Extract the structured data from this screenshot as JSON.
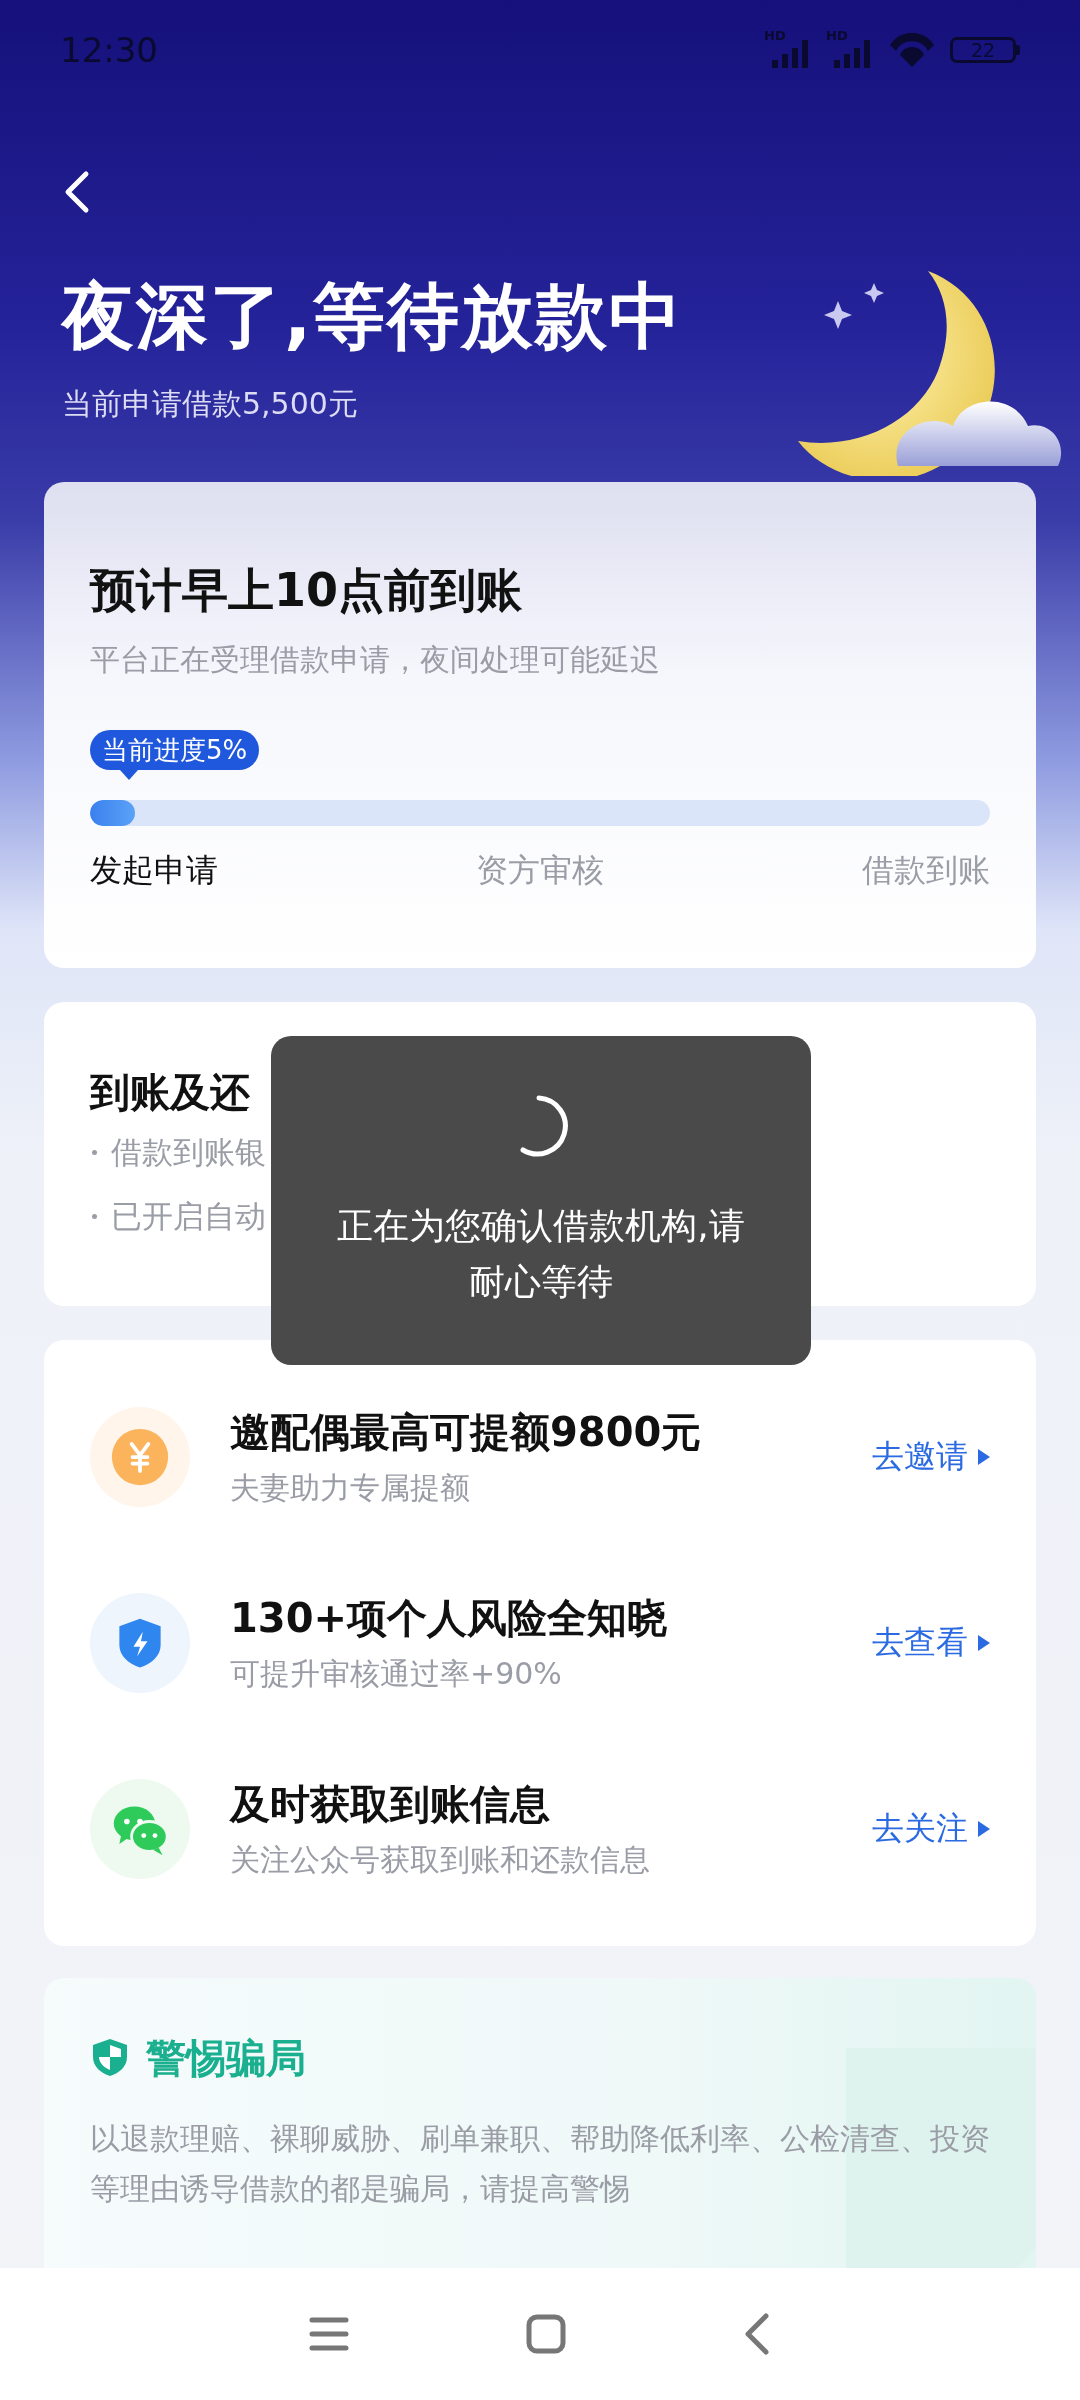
{
  "status_bar": {
    "time": "12:30",
    "signals": [
      {
        "label": "HD"
      },
      {
        "label": "HD"
      }
    ],
    "battery": "22"
  },
  "header": {
    "title": "夜深了,等待放款中",
    "subtitle": "当前申请借款5,500元"
  },
  "progress_card": {
    "title": "预计早上10点前到账",
    "subtitle": "平台正在受理借款申请，夜间处理可能延迟",
    "badge": "当前进度5%",
    "level": 0.05,
    "steps": [
      {
        "label": "发起申请",
        "done": true
      },
      {
        "label": "资方审核",
        "done": false
      },
      {
        "label": "借款到账",
        "done": false
      }
    ]
  },
  "reminder_card": {
    "title": "到账及还",
    "lines": [
      {
        "parts": [
          "借款到账银"
        ]
      },
      {
        "parts": [
          "已开启自动"
        ]
      }
    ]
  },
  "offers": [
    {
      "kind": "yen",
      "title": "邀配偶最高可提额9800元",
      "subtitle": "夫妻助力专属提额",
      "action": "去邀请"
    },
    {
      "kind": "shield",
      "title": "130+项个人风险全知晓",
      "subtitle": "可提升审核通过率+90%",
      "action": "去查看"
    },
    {
      "kind": "chat",
      "title": "及时获取到账信息",
      "subtitle": "关注公众号获取到账和还款信息",
      "action": "去关注"
    }
  ],
  "warning": {
    "title": "警惕骗局",
    "text": "以退款理赔、裸聊威胁、刷单兼职、帮助降低利率、公检清查、投资等理由诱导借款的都是骗局，请提高警惕"
  },
  "toast": {
    "message": "正在为您确认借款机构,请耐心等待"
  }
}
